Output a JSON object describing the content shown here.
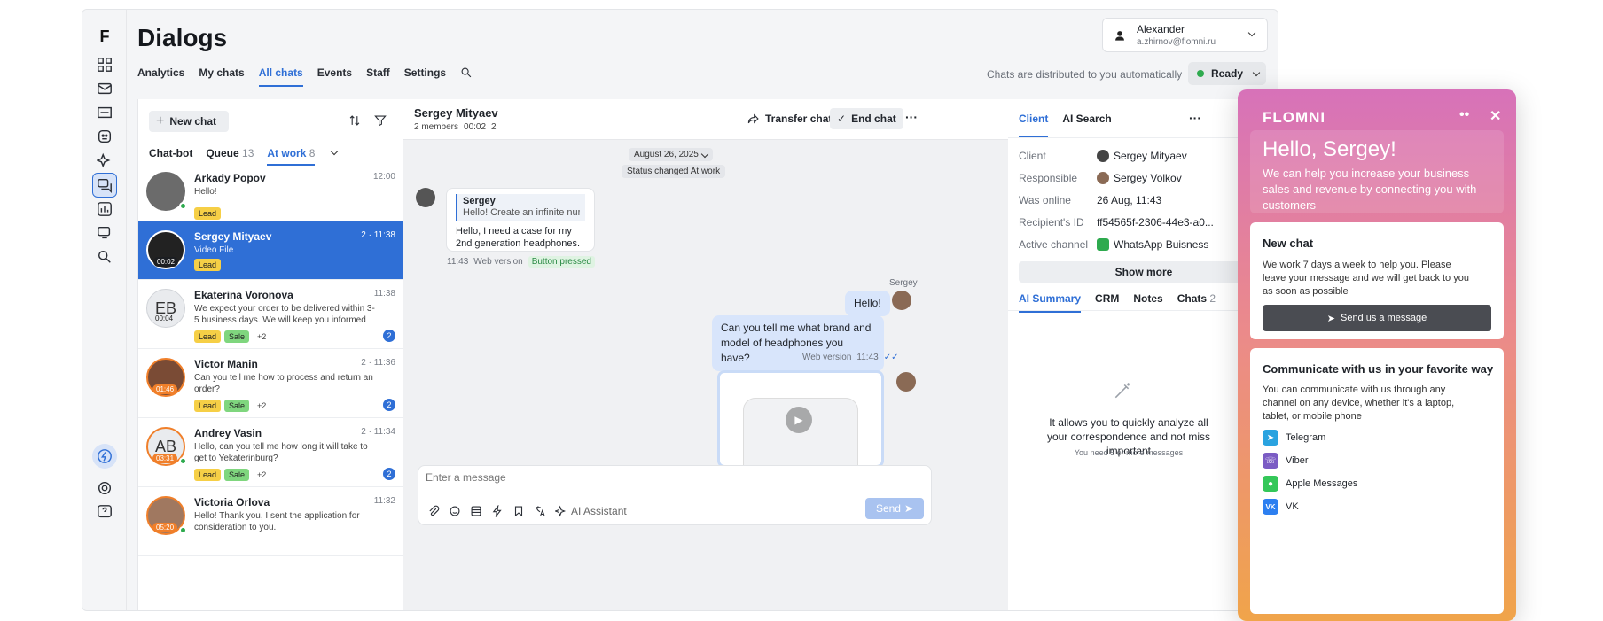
{
  "app": {
    "logo": "F",
    "title": "Dialogs",
    "nav": [
      "Analytics",
      "My chats",
      "All chats",
      "Events",
      "Staff",
      "Settings"
    ],
    "active_nav": "All chats",
    "distribution_note": "Chats are distributed to you automatically",
    "status": "Ready",
    "user": {
      "name": "Alexander",
      "email": "a.zhirnov@flomni.ru"
    }
  },
  "list": {
    "new_chat_label": "New chat",
    "tabs": [
      {
        "label": "Chat-bot",
        "count": ""
      },
      {
        "label": "Queue",
        "count": "13"
      },
      {
        "label": "At work",
        "count": "8"
      }
    ],
    "items": [
      {
        "name": "Arkady Popov",
        "time": "12:00",
        "msg": "Hello!",
        "tags": [
          "Lead"
        ],
        "unread": ""
      },
      {
        "name": "Sergey Mityaev",
        "time": "2 · 11:38",
        "msg": "Video File",
        "tags": [
          "Lead"
        ],
        "timer": "00:02",
        "unread": ""
      },
      {
        "name": "Ekaterina Voronova",
        "time": "11:38",
        "msg": "We expect your order to be delivered within 3-5 business days. We will keep you informed and help",
        "tags": [
          "Lead",
          "Sale",
          "+2"
        ],
        "initials": "EB",
        "timer": "00:04",
        "unread": "2"
      },
      {
        "name": "Victor Manin",
        "time": "2 · 11:36",
        "msg": "Can you tell me how to process and return an order?",
        "tags": [
          "Lead",
          "Sale",
          "+2"
        ],
        "timer": "01:46",
        "unread": "2"
      },
      {
        "name": "Andrey Vasin",
        "time": "2 · 11:34",
        "msg": "Hello, can you tell me how long it will take to get to Yekaterinburg?",
        "tags": [
          "Lead",
          "Sale",
          "+2"
        ],
        "initials": "AB",
        "timer": "03:31",
        "unread": "2"
      },
      {
        "name": "Victoria Orlova",
        "time": "11:32",
        "msg": "Hello! Thank you, I sent the application for consideration to you.",
        "timer": "05:20",
        "unread": ""
      }
    ]
  },
  "chat": {
    "contact": "Sergey Mityaev",
    "members": "2 members",
    "duration": "00:02",
    "files": "2",
    "transfer_label": "Transfer chat",
    "end_label": "End chat",
    "date_chip": "August 26, 2025",
    "status_chip": "Status changed At work",
    "quote_author": "Sergey",
    "quote_text": "Hello! Create an infinite numb...",
    "incoming_text": "Hello, I need a case for my 2nd generation headphones.",
    "incoming_time": "11:43",
    "incoming_source": "Web version",
    "incoming_badge": "Button pressed",
    "agent_name": "Sergey",
    "out1": "Hello!",
    "out2": "Can you tell me what brand and model of headphones you have?",
    "out_source": "Web version",
    "out_time": "11:43",
    "composer_placeholder": "Enter a message",
    "ai_assistant": "AI Assistant",
    "send_label": "Send"
  },
  "client": {
    "tabs": [
      "Client",
      "AI Search"
    ],
    "rows": [
      {
        "label": "Client",
        "value": "Sergey Mityaev"
      },
      {
        "label": "Responsible",
        "value": "Sergey Volkov"
      },
      {
        "label": "Was online",
        "value": "26 Aug, 11:43"
      },
      {
        "label": "Recipient's ID",
        "value": "ff54565f-2306-44e3-a0..."
      },
      {
        "label": "Active channel",
        "value": "WhatsApp Buisness"
      }
    ],
    "show_more": "Show more",
    "subtabs": [
      "AI Summary",
      "CRM",
      "Notes",
      "Chats"
    ],
    "chats_count": "2",
    "ai_text": "It allows you to quickly analyze all your correspondence and not miss important",
    "ai_note": "You need 5 or more messages"
  },
  "widget": {
    "brand": "FLOMNI",
    "greeting": "Hello, Sergey!",
    "subtitle": "We can help you increase your business sales and revenue by connecting you with customers",
    "new_chat_title": "New chat",
    "new_chat_text": "We work 7 days a week to help you. Please leave your message and we will get back to you as soon as possible",
    "send_button": "Send us a message",
    "channels_title": "Communicate with us in your favorite way",
    "channels_text": "You can communicate with us through any channel on any device, whether it's a laptop, tablet, or mobile phone",
    "channels": [
      {
        "name": "Telegram",
        "color": "#2aa3e0"
      },
      {
        "name": "Viber",
        "color": "#7b5cc4"
      },
      {
        "name": "Apple Messages",
        "color": "#34c759"
      },
      {
        "name": "VK",
        "color": "#2d7ff0"
      }
    ]
  },
  "colors": {
    "accent": "#2f6fd6",
    "lead": "#f6cf46",
    "sale": "#7fd67e",
    "online": "#2eaa4e"
  }
}
